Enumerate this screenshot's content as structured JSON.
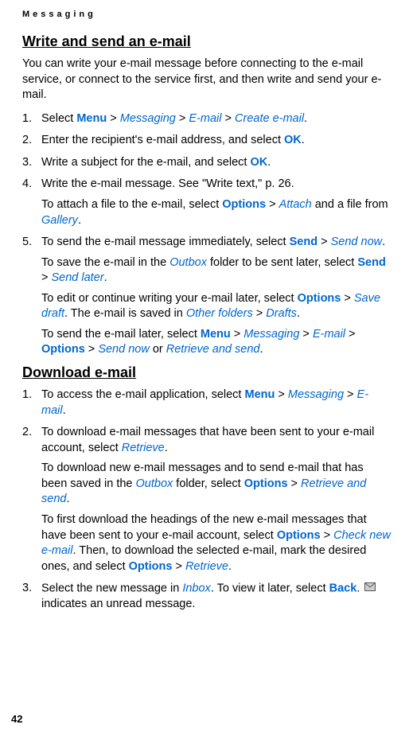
{
  "header": "Messaging",
  "section1": {
    "title": "Write and send an e-mail",
    "intro": "You can write your e-mail message before connecting to the e-mail service, or connect to the service first, and then write and send your e-mail.",
    "items": {
      "s1_pre": "Select ",
      "s1_menu": "Menu",
      "s1_gt1": " > ",
      "s1_messaging": "Messaging",
      "s1_gt2": " > ",
      "s1_email": "E-mail",
      "s1_gt3": " > ",
      "s1_create": "Create e-mail",
      "s1_dot": ".",
      "s2_pre": "Enter the recipient's e-mail address, and select ",
      "s2_ok": "OK",
      "s2_dot": ".",
      "s3_pre": "Write a subject for the e-mail, and select ",
      "s3_ok": "OK",
      "s3_dot": ".",
      "s4_a": "Write the e-mail message. See \"Write text,\" p. 26.",
      "s4_b_pre": "To attach a file to the e-mail, select ",
      "s4_b_options": "Options",
      "s4_b_gt": " > ",
      "s4_b_attach": "Attach",
      "s4_b_mid": " and a file from ",
      "s4_b_gallery": "Gallery",
      "s4_b_dot": ".",
      "s5_a_pre": "To send the e-mail message immediately, select ",
      "s5_a_send": "Send",
      "s5_a_gt": " > ",
      "s5_a_sendnow": "Send now",
      "s5_a_dot": ".",
      "s5_b_pre": "To save the e-mail in the ",
      "s5_b_outbox": "Outbox",
      "s5_b_mid": " folder to be sent later, select ",
      "s5_b_send": "Send",
      "s5_b_gt": " > ",
      "s5_b_sendlater": "Send later",
      "s5_b_dot": ".",
      "s5_c_pre": "To edit or continue writing your e-mail later, select ",
      "s5_c_options": "Options",
      "s5_c_gt1": " > ",
      "s5_c_savedraft": "Save draft",
      "s5_c_mid": ". The e-mail is saved in ",
      "s5_c_otherfolders": "Other folders",
      "s5_c_gt2": " > ",
      "s5_c_drafts": "Drafts",
      "s5_c_dot": ".",
      "s5_d_pre": "To send the e-mail later, select ",
      "s5_d_menu": "Menu",
      "s5_d_gt1": " > ",
      "s5_d_messaging": "Messaging",
      "s5_d_gt2": " > ",
      "s5_d_email": "E-mail",
      "s5_d_gt3": " > ",
      "s5_d_options": "Options",
      "s5_d_gt4": " > ",
      "s5_d_sendnow": "Send now",
      "s5_d_or": " or ",
      "s5_d_retrieve": "Retrieve and send",
      "s5_d_dot": "."
    }
  },
  "section2": {
    "title": "Download e-mail",
    "items": {
      "d1_pre": "To access the e-mail application, select ",
      "d1_menu": "Menu",
      "d1_gt1": " > ",
      "d1_messaging": "Messaging",
      "d1_gt2": " > ",
      "d1_email": "E-mail",
      "d1_dot": ".",
      "d2_a_pre": "To download e-mail messages that have been sent to your e-mail account, select ",
      "d2_a_retrieve": "Retrieve",
      "d2_a_dot": ".",
      "d2_b_pre": "To download new e-mail messages and to send e-mail that has been saved in the ",
      "d2_b_outbox": "Outbox",
      "d2_b_mid": " folder, select ",
      "d2_b_options": "Options",
      "d2_b_gt": " > ",
      "d2_b_retrieve": "Retrieve and send",
      "d2_b_dot": ".",
      "d2_c_pre": "To first download the headings of the new e-mail messages that have been sent to your e-mail account, select ",
      "d2_c_options": "Options",
      "d2_c_gt1": " > ",
      "d2_c_check": "Check new e-mail",
      "d2_c_mid": ". Then, to download the selected e-mail, mark the desired ones, and select ",
      "d2_c_options2": "Options",
      "d2_c_gt2": " > ",
      "d2_c_retrieve": "Retrieve",
      "d2_c_dot": ".",
      "d3_pre": "Select the new message in ",
      "d3_inbox": "Inbox",
      "d3_mid": ". To view it later, select ",
      "d3_back": "Back",
      "d3_dot": ". ",
      "d3_post": " indicates an unread message."
    }
  },
  "page_number": "42"
}
